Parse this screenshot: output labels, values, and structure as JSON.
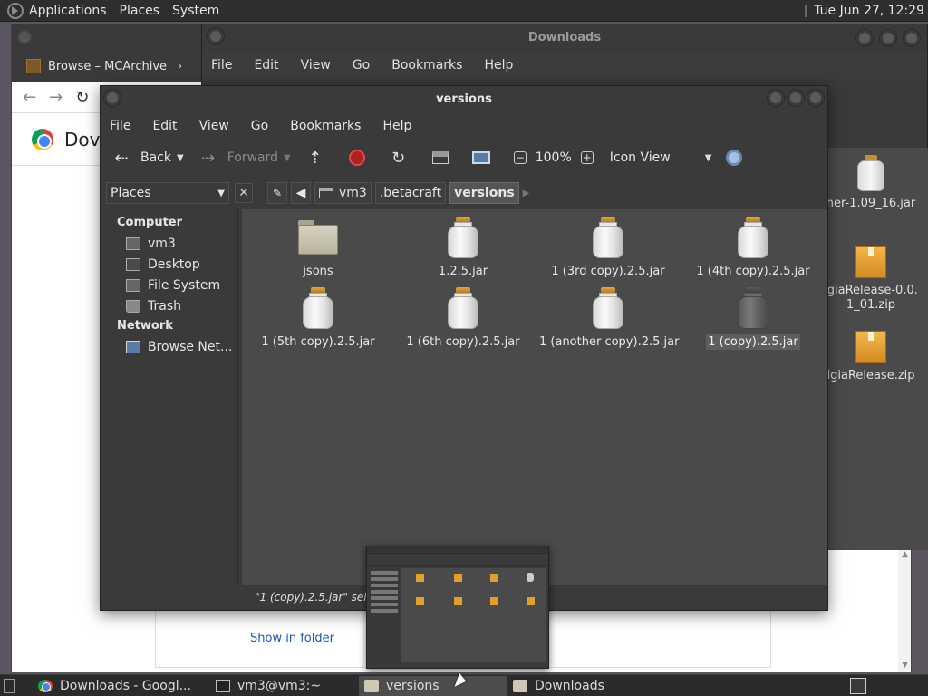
{
  "top_panel": {
    "menus": [
      "Applications",
      "Places",
      "System"
    ],
    "clock": "Tue Jun 27, 12:29"
  },
  "chrome": {
    "tab_title": "Browse – MCArchive",
    "page_title": "Dov",
    "link": "Show in folder"
  },
  "downloads_window": {
    "title": "Downloads",
    "menu": [
      "File",
      "Edit",
      "View",
      "Go",
      "Bookmarks",
      "Help"
    ],
    "items": [
      {
        "name": "her-1.09_16.jar",
        "kind": "jar"
      },
      {
        "name": "lgiaRelease-0.0.\n1_01.zip",
        "kind": "zip"
      },
      {
        "name": "lgiaRelease.zip",
        "kind": "zip"
      }
    ]
  },
  "versions_window": {
    "title": "versions",
    "menu": [
      "File",
      "Edit",
      "View",
      "Go",
      "Bookmarks",
      "Help"
    ],
    "toolbar": {
      "back": "Back",
      "forward": "Forward",
      "zoom": "100%",
      "view_mode": "Icon View"
    },
    "places_label": "Places",
    "breadcrumbs": [
      "vm3",
      ".betacraft",
      "versions"
    ],
    "sidebar": {
      "computer_header": "Computer",
      "computer_items": [
        "vm3",
        "Desktop",
        "File System",
        "Trash"
      ],
      "network_header": "Network",
      "network_items": [
        "Browse Net..."
      ]
    },
    "files": [
      {
        "name": "jsons",
        "kind": "folder",
        "selected": false
      },
      {
        "name": "1.2.5.jar",
        "kind": "jar",
        "selected": false
      },
      {
        "name": "1 (3rd copy).2.5.jar",
        "kind": "jar",
        "selected": false
      },
      {
        "name": "1 (4th copy).2.5.jar",
        "kind": "jar",
        "selected": false
      },
      {
        "name": "1 (5th copy).2.5.jar",
        "kind": "jar",
        "selected": false
      },
      {
        "name": "1 (6th copy).2.5.jar",
        "kind": "jar",
        "selected": false
      },
      {
        "name": "1 (another copy).2.5.jar",
        "kind": "jar",
        "selected": false
      },
      {
        "name": "1 (copy).2.5.jar",
        "kind": "jar",
        "selected": true
      }
    ],
    "status": "\"1 (copy).2.5.jar\" selected"
  },
  "taskbar": [
    {
      "label": "Downloads - Googl...",
      "icon": "chrome-icon",
      "active": false
    },
    {
      "label": "vm3@vm3:~",
      "icon": "terminal-icon",
      "active": false
    },
    {
      "label": "versions",
      "icon": "folder-icon",
      "active": true
    },
    {
      "label": "Downloads",
      "icon": "folder-icon",
      "active": false
    }
  ]
}
